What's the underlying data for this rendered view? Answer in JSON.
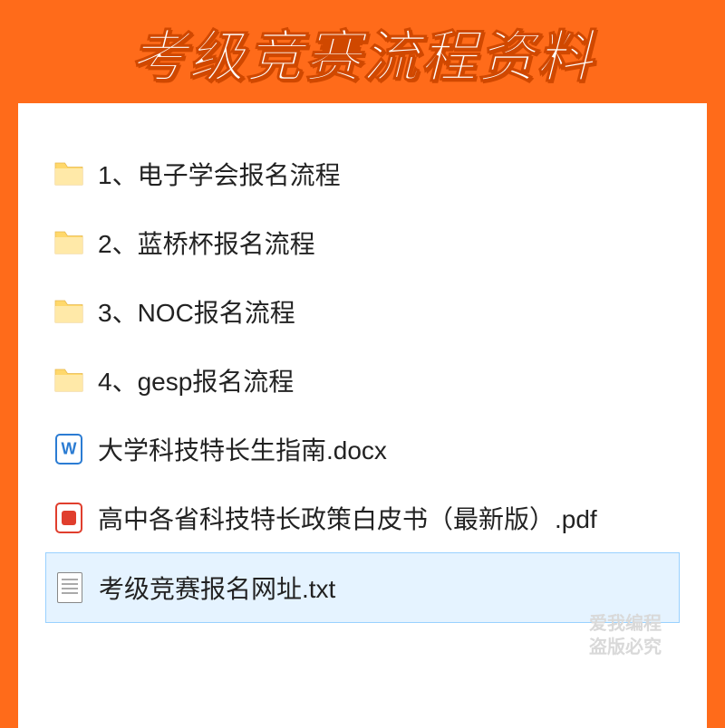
{
  "header": {
    "title": "考级竞赛流程资料"
  },
  "files": [
    {
      "type": "folder",
      "name": "1、电子学会报名流程",
      "selected": false
    },
    {
      "type": "folder",
      "name": "2、蓝桥杯报名流程",
      "selected": false
    },
    {
      "type": "folder",
      "name": "3、NOC报名流程",
      "selected": false
    },
    {
      "type": "folder",
      "name": "4、gesp报名流程",
      "selected": false
    },
    {
      "type": "docx",
      "name": "大学科技特长生指南.docx",
      "selected": false
    },
    {
      "type": "pdf",
      "name": "高中各省科技特长政策白皮书（最新版）.pdf",
      "selected": false
    },
    {
      "type": "txt",
      "name": "考级竞赛报名网址.txt",
      "selected": true
    }
  ],
  "watermark": {
    "line1": "爱我编程",
    "line2": "盗版必究"
  }
}
